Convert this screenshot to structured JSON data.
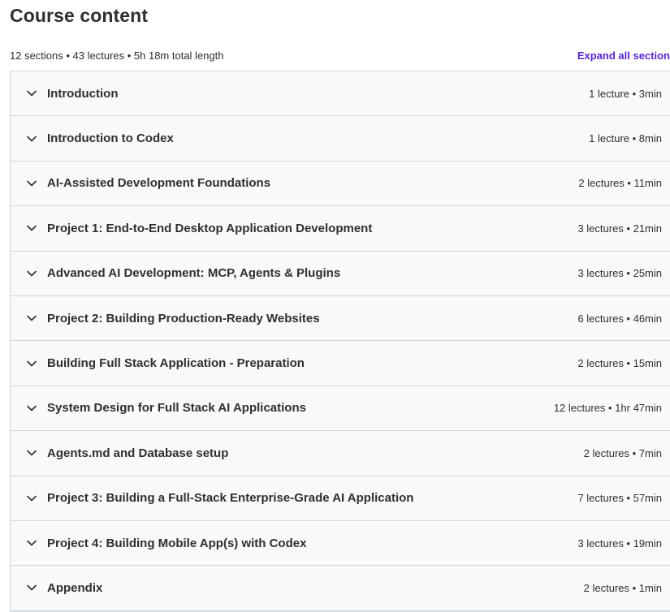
{
  "header": {
    "title": "Course content",
    "summary": "12 sections • 43 lectures • 5h 18m total length",
    "expand_all_label": "Expand all section"
  },
  "icons": {
    "section_toggle": "chevron-down-icon"
  },
  "colors": {
    "accent": "#5624d0",
    "section_bg": "#f7f9fa",
    "border": "#d1d7dc",
    "text": "#2d2f31"
  },
  "sections": [
    {
      "title": "Introduction",
      "meta": "1 lecture • 3min"
    },
    {
      "title": "Introduction to Codex",
      "meta": "1 lecture • 8min"
    },
    {
      "title": "AI-Assisted Development Foundations",
      "meta": "2 lectures • 11min"
    },
    {
      "title": "Project 1: End-to-End Desktop Application Development",
      "meta": "3 lectures • 21min"
    },
    {
      "title": "Advanced AI Development: MCP, Agents & Plugins",
      "meta": "3 lectures • 25min"
    },
    {
      "title": "Project 2: Building Production-Ready Websites",
      "meta": "6 lectures • 46min"
    },
    {
      "title": "Building Full Stack Application - Preparation",
      "meta": "2 lectures • 15min"
    },
    {
      "title": "System Design for Full Stack AI Applications",
      "meta": "12 lectures • 1hr 47min"
    },
    {
      "title": "Agents.md and Database setup",
      "meta": "2 lectures • 7min"
    },
    {
      "title": "Project 3: Building a Full-Stack Enterprise-Grade AI Application",
      "meta": "7 lectures • 57min"
    },
    {
      "title": "Project 4: Building Mobile App(s) with Codex",
      "meta": "3 lectures • 19min"
    },
    {
      "title": "Appendix",
      "meta": "2 lectures • 1min"
    }
  ]
}
